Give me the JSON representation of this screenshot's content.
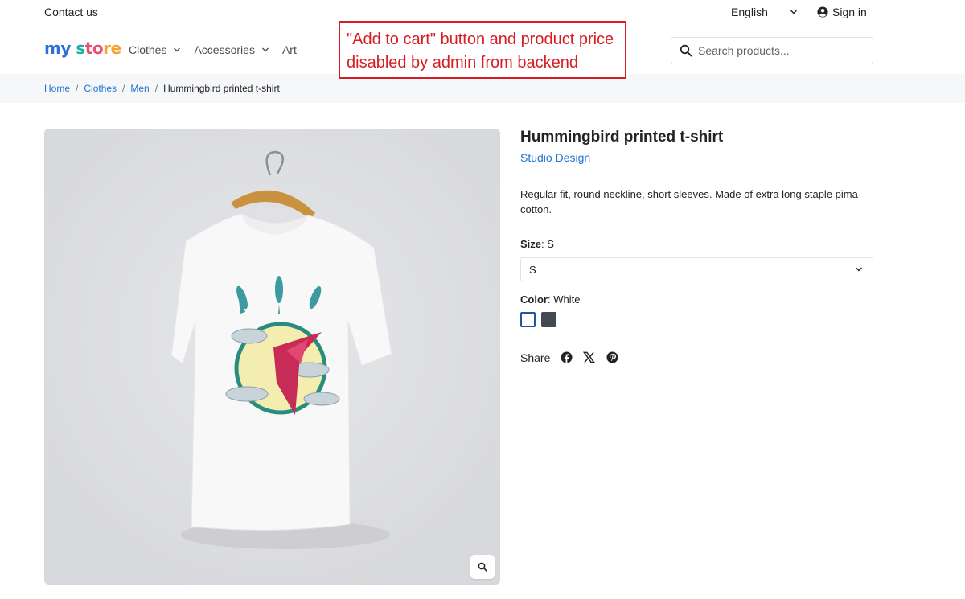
{
  "topbar": {
    "contact": "Contact us",
    "language": "English",
    "sign_in": "Sign in"
  },
  "header": {
    "logo": {
      "part1": "my",
      "part2": "s",
      "part3": "to",
      "part4": "re"
    },
    "nav": [
      {
        "label": "Clothes",
        "has_dropdown": true
      },
      {
        "label": "Accessories",
        "has_dropdown": true
      },
      {
        "label": "Art",
        "has_dropdown": false
      }
    ],
    "search_placeholder": "Search products..."
  },
  "annotation": {
    "line1": "\"Add to cart\" button and product price",
    "line2": "disabled by admin from backend"
  },
  "breadcrumb": {
    "items": [
      "Home",
      "Clothes",
      "Men"
    ],
    "current": "Hummingbird printed t-shirt"
  },
  "product": {
    "title": "Hummingbird printed t-shirt",
    "brand": "Studio Design",
    "description": "Regular fit, round neckline, short sleeves. Made of extra long staple pima cotton.",
    "size_label": "Size",
    "size_value": "S",
    "size_selected": "S",
    "color_label": "Color",
    "color_value": "White",
    "colors": [
      "#ffffff",
      "#434a54"
    ],
    "share_label": "Share",
    "share_icons": [
      "facebook-icon",
      "x-icon",
      "pinterest-icon"
    ]
  },
  "colors": {
    "link": "#2473d4",
    "annotation": "#d81d22",
    "breadcrumb_bg": "#f6f7f9",
    "image_bg": "#dedfe2"
  }
}
